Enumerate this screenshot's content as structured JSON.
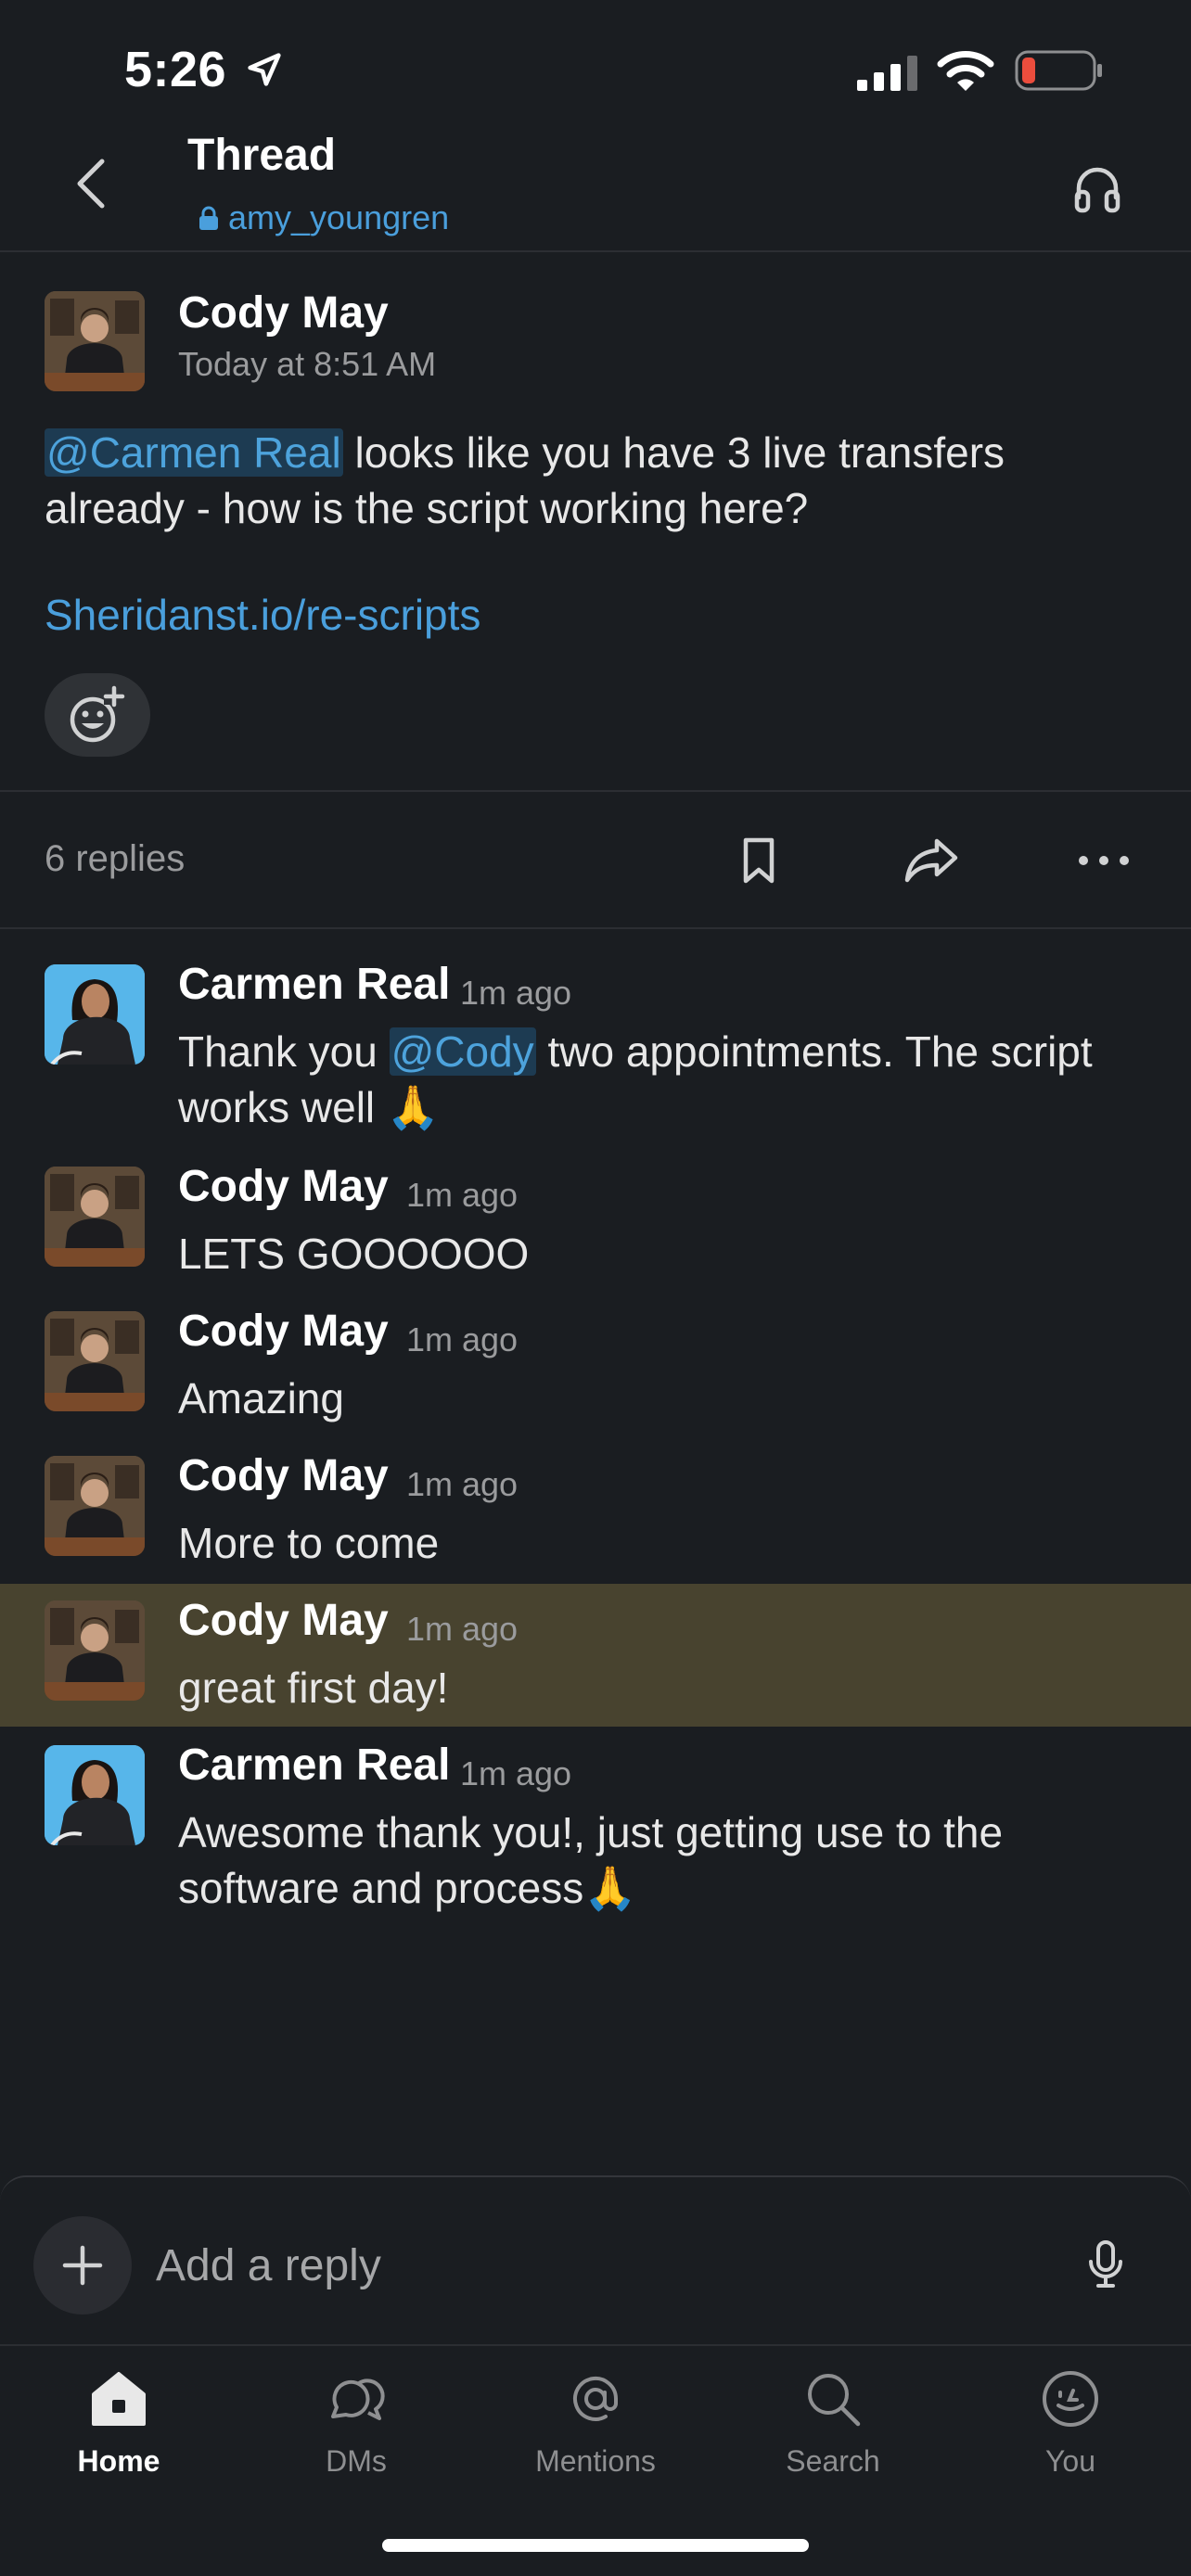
{
  "status_bar": {
    "time": "5:26"
  },
  "header": {
    "title": "Thread",
    "channel": "amy_youngren"
  },
  "parent_message": {
    "author": "Cody May",
    "time": "Today at 8:51 AM",
    "mention": "@Carmen Real",
    "text_after_mention": " looks like you have 3 live transfers already - how is the script working here?",
    "link": "Sheridanst.io/re-scripts"
  },
  "replies_bar": {
    "count_label": "6 replies"
  },
  "replies": [
    {
      "author": "Carmen Real",
      "time": "1m ago",
      "text_before": "Thank you ",
      "mention": "@Cody",
      "text_after": " two appointments. The script works well 🙏"
    },
    {
      "author": "Cody May",
      "time": "1m ago",
      "text": "LETS GOOOOOO"
    },
    {
      "author": "Cody May",
      "time": "1m ago",
      "text": "Amazing"
    },
    {
      "author": "Cody May",
      "time": "1m ago",
      "text": "More to come"
    },
    {
      "author": "Cody May",
      "time": "1m ago",
      "text": "great first day!"
    },
    {
      "author": "Carmen Real",
      "time": "1m ago",
      "text": "Awesome thank you!, just getting use to the software and process🙏"
    }
  ],
  "composer": {
    "placeholder": "Add a reply"
  },
  "tabs": [
    {
      "label": "Home",
      "icon": "home-icon"
    },
    {
      "label": "DMs",
      "icon": "dms-icon"
    },
    {
      "label": "Mentions",
      "icon": "mentions-icon"
    },
    {
      "label": "Search",
      "icon": "search-icon"
    },
    {
      "label": "You",
      "icon": "you-icon"
    }
  ],
  "colors": {
    "background": "#1a1d21",
    "link": "#4a9fdc",
    "highlight_row": "#48432f",
    "battery_low": "#eb4d3d"
  }
}
